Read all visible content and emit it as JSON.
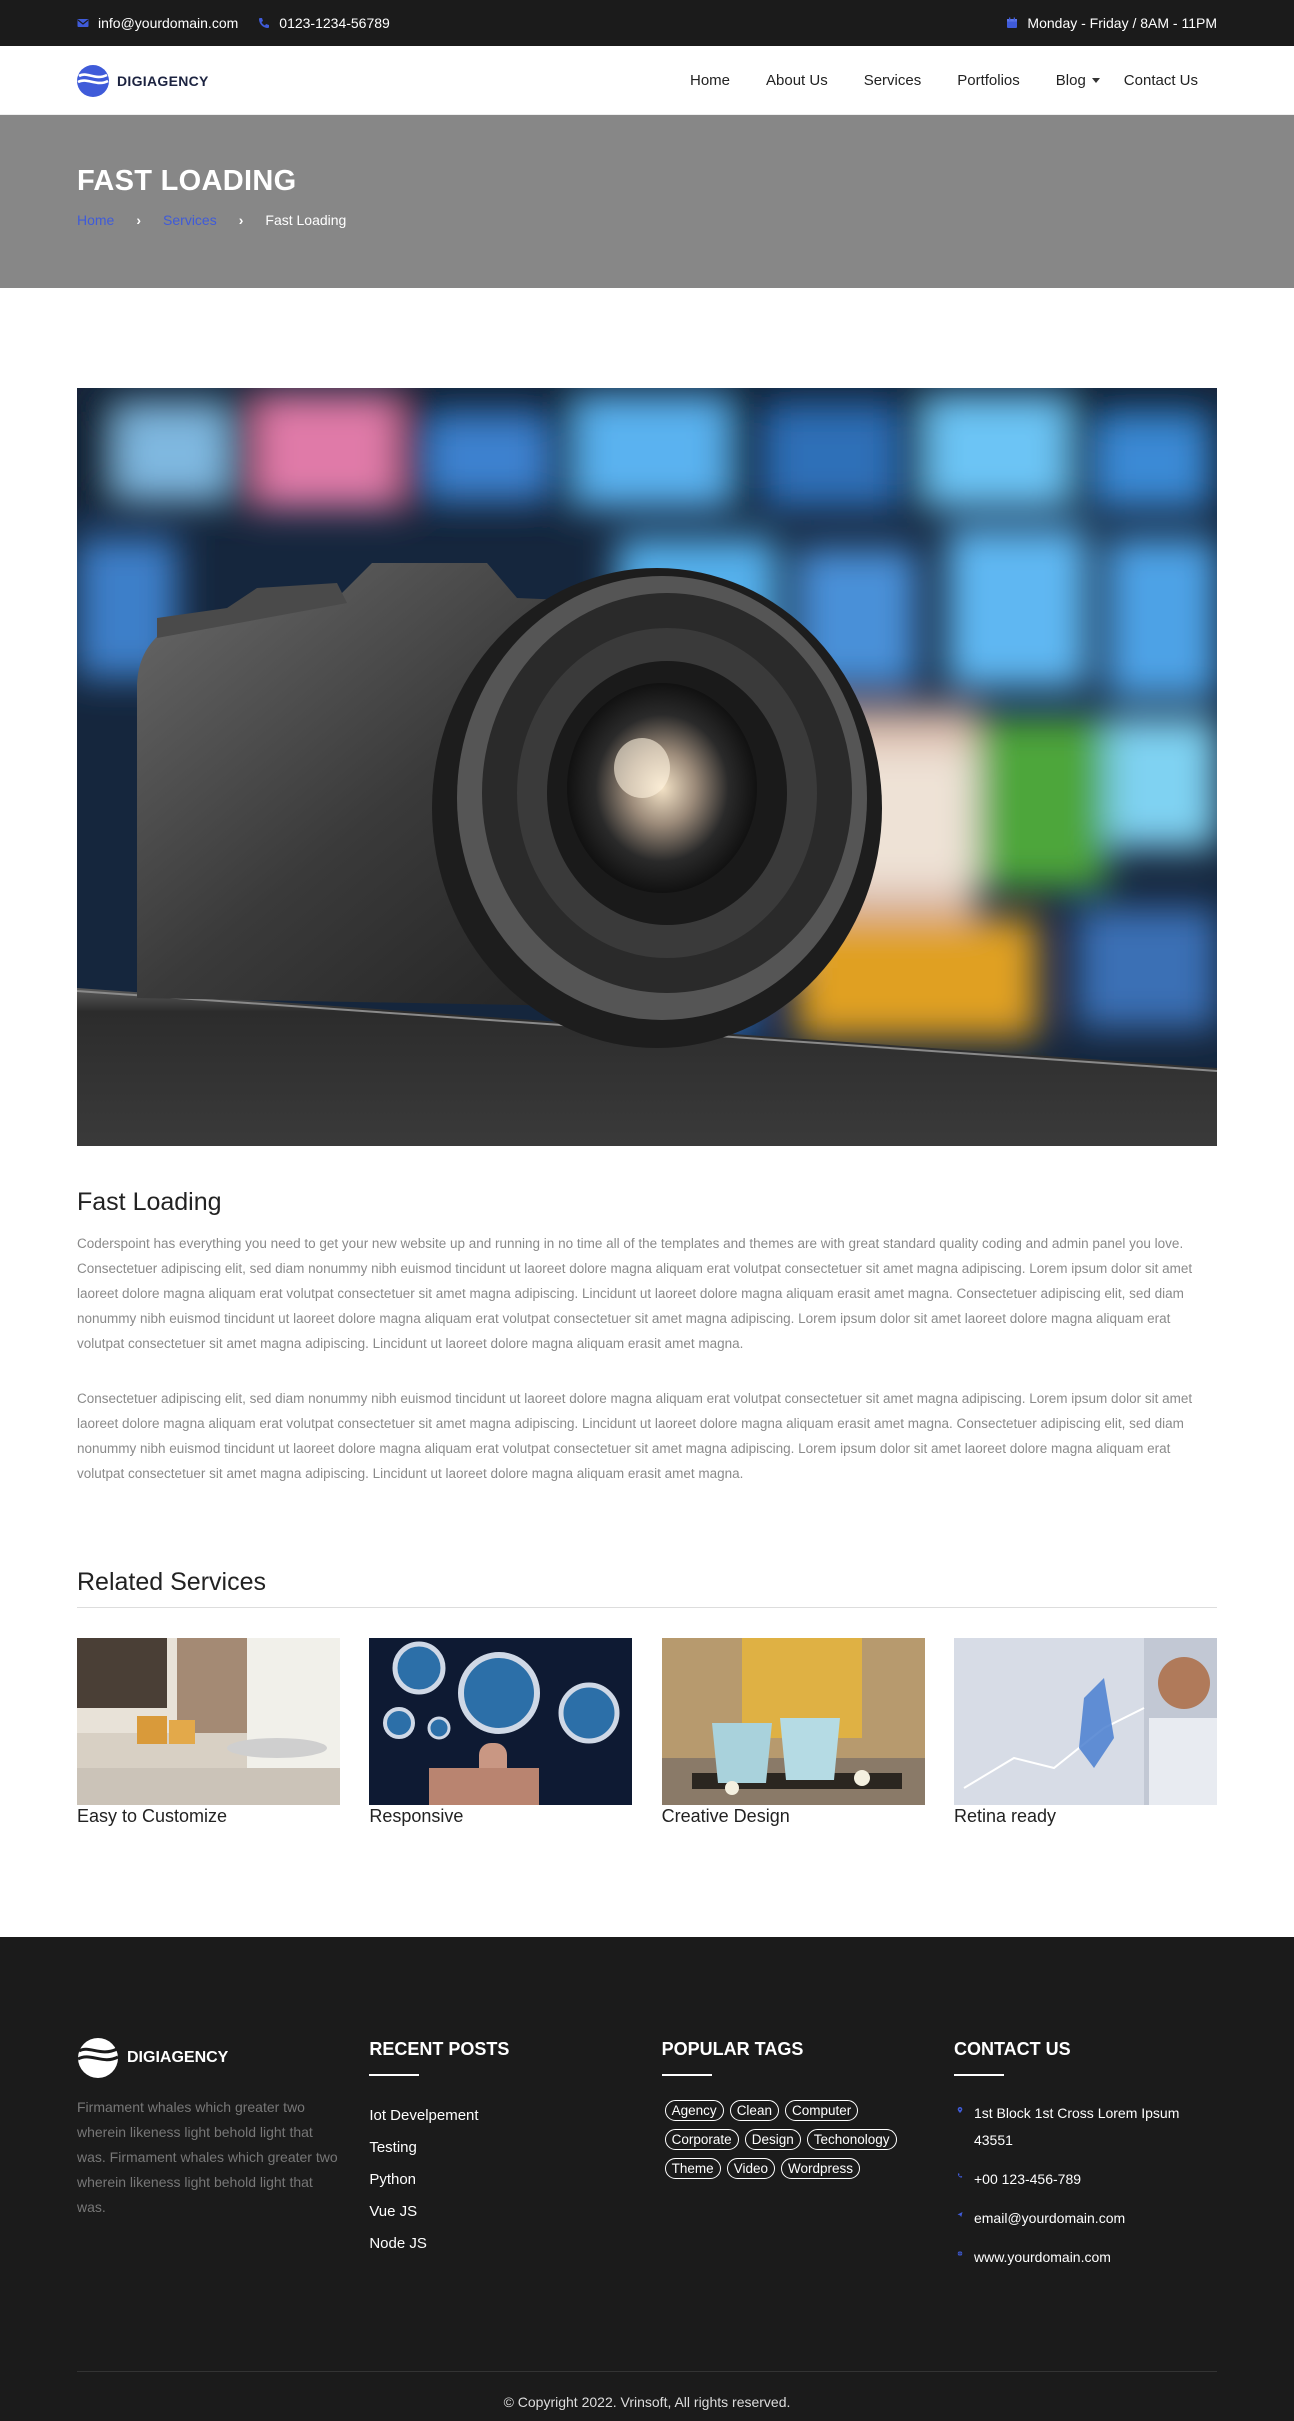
{
  "topbar": {
    "email": "info@yourdomain.com",
    "phone": "0123-1234-56789",
    "hours": "Monday - Friday / 8AM - 11PM"
  },
  "header": {
    "logo_text": "DIGIAGENCY",
    "nav": [
      "Home",
      "About Us",
      "Services",
      "Portfolios",
      "Blog",
      "Contact Us"
    ]
  },
  "banner": {
    "title": "FAST LOADING",
    "breadcrumb": {
      "home": "Home",
      "services": "Services",
      "current": "Fast Loading"
    }
  },
  "content": {
    "title": "Fast Loading",
    "para1": "Coderspoint has everything you need to get your new website up and running in no time all of the templates and themes are with great standard quality coding and admin panel you love.  Consectetuer adipiscing elit, sed diam nonummy nibh euismod tincidunt ut laoreet dolore magna aliquam erat volutpat consectetuer sit amet magna adipiscing. Lorem ipsum dolor sit amet laoreet dolore magna aliquam erat volutpat consectetuer sit amet magna adipiscing. Lincidunt ut laoreet dolore magna aliquam erasit amet magna. Consectetuer adipiscing elit, sed diam nonummy nibh euismod tincidunt ut laoreet dolore magna aliquam erat volutpat consectetuer sit amet magna adipiscing. Lorem ipsum dolor sit amet laoreet dolore magna aliquam erat volutpat consectetuer sit amet magna adipiscing. Lincidunt ut laoreet dolore magna aliquam erasit amet magna.",
    "para2": "Consectetuer adipiscing elit, sed diam nonummy nibh euismod tincidunt ut laoreet dolore magna aliquam erat volutpat consectetuer sit amet magna adipiscing. Lorem ipsum dolor sit amet laoreet dolore magna aliquam erat volutpat consectetuer sit amet magna adipiscing. Lincidunt ut laoreet dolore magna aliquam erasit amet magna. Consectetuer adipiscing elit, sed diam nonummy nibh euismod tincidunt ut laoreet dolore magna aliquam erat volutpat consectetuer sit amet magna adipiscing. Lorem ipsum dolor sit amet laoreet dolore magna aliquam erat volutpat consectetuer sit amet magna adipiscing. Lincidunt ut laoreet dolore magna aliquam erasit amet magna."
  },
  "related": {
    "title": "Related Services",
    "items": [
      "Easy to Customize",
      "Responsive",
      "Creative Design",
      "Retina ready"
    ]
  },
  "footer": {
    "logo_text": "DIGIAGENCY",
    "about": "Firmament whales which greater two wherein likeness light behold light that was. Firmament whales which greater two wherein likeness light behold light that was.",
    "recent_posts": {
      "heading": "RECENT POSTS",
      "items": [
        "Iot Develpement",
        "Testing",
        "Python",
        "Vue JS",
        "Node JS"
      ]
    },
    "popular_tags": {
      "heading": "POPULAR TAGS",
      "items": [
        "Agency",
        "Clean",
        "Computer",
        "Corporate",
        "Design",
        "Techonology",
        "Theme",
        "Video",
        "Wordpress"
      ]
    },
    "contact": {
      "heading": "CONTACT US",
      "address": "1st Block 1st Cross Lorem Ipsum 43551",
      "phone": "+00 123-456-789",
      "email": "email@yourdomain.com",
      "website": "www.yourdomain.com"
    },
    "copyright": "© Copyright 2022. Vrinsoft, All rights reserved."
  },
  "colors": {
    "accent": "#3f5bd9",
    "dark": "#1b1b1b",
    "banner": "#878787"
  }
}
